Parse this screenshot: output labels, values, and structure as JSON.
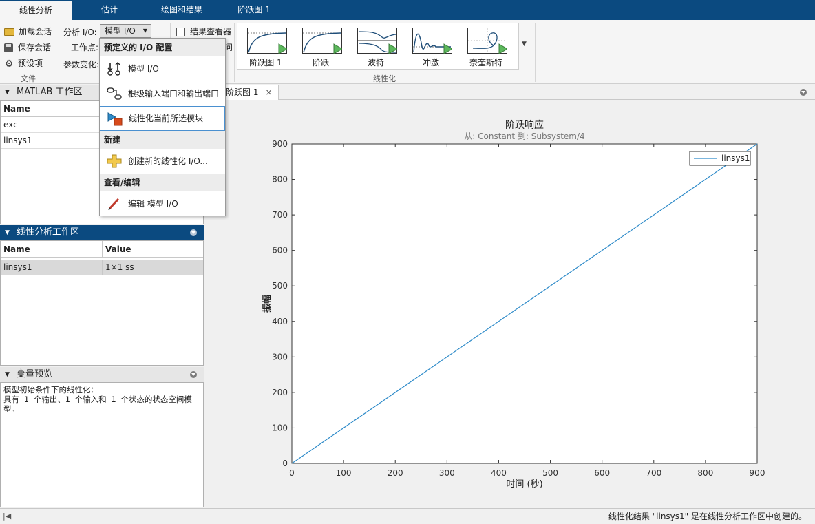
{
  "tabs": [
    {
      "label": "线性分析",
      "active": true
    },
    {
      "label": "估计",
      "active": false
    },
    {
      "label": "绘图和结果",
      "active": false
    },
    {
      "label": "阶跃图 1",
      "active": false
    }
  ],
  "ribbon": {
    "file": {
      "load_session": "加载会话",
      "save_session": "保存会话",
      "preferences": "预设项",
      "section_label": "文件"
    },
    "analysis_io_label": "分析 I/O:",
    "analysis_io_value": "模型 I/O",
    "operating_point_label": "工作点:",
    "param_variation_label": "参数变化:",
    "result_viewer_label": "结果查看器",
    "truncated_char": "问",
    "gallery": [
      "阶跃图 1",
      "阶跃",
      "波特",
      "冲激",
      "奈奎斯特"
    ],
    "linearize_label": "线性化"
  },
  "dropdown": {
    "predefined_header": "预定义的 I/O 配置",
    "items": [
      "模型 I/O",
      "根级输入端口和输出端口",
      "线性化当前所选模块"
    ],
    "new_header": "新建",
    "new_item": "创建新的线性化 I/O...",
    "view_header": "查看/编辑",
    "edit_item": "编辑 模型 I/O"
  },
  "matlab_workspace": {
    "title": "MATLAB 工作区",
    "col_name": "Name",
    "rows": [
      "exc",
      "linsys1"
    ]
  },
  "linear_workspace": {
    "title": "线性分析工作区",
    "col_name": "Name",
    "col_value": "Value",
    "rows": [
      {
        "name": "linsys1",
        "value": "1×1 ss"
      }
    ]
  },
  "variable_preview": {
    "title": "变量预览",
    "lines": [
      "模型初始条件下的线性化：",
      "具有 1 个输出、1 个输入和 1 个状态的状态空间模",
      "型。"
    ]
  },
  "figure_tab": {
    "label": "阶跃图 1",
    "close": "×"
  },
  "status": {
    "message": "线性化结果 \"linsys1\" 是在线性分析工作区中创建的。",
    "left": "|◀"
  },
  "chart_data": {
    "type": "line",
    "title": "阶跃响应",
    "subtitle": "从: Constant  到: Subsystem/4",
    "xlabel": "时间 (秒)",
    "ylabel": "振幅",
    "xlim": [
      0,
      900
    ],
    "ylim": [
      0,
      900
    ],
    "xticks": [
      0,
      100,
      200,
      300,
      400,
      500,
      600,
      700,
      800,
      900
    ],
    "yticks": [
      0,
      100,
      200,
      300,
      400,
      500,
      600,
      700,
      800,
      900
    ],
    "legend_location": "top-right",
    "series": [
      {
        "name": "linsys1",
        "color": "#2e8bc9",
        "x": [
          0,
          900
        ],
        "y": [
          0,
          900
        ]
      }
    ]
  }
}
